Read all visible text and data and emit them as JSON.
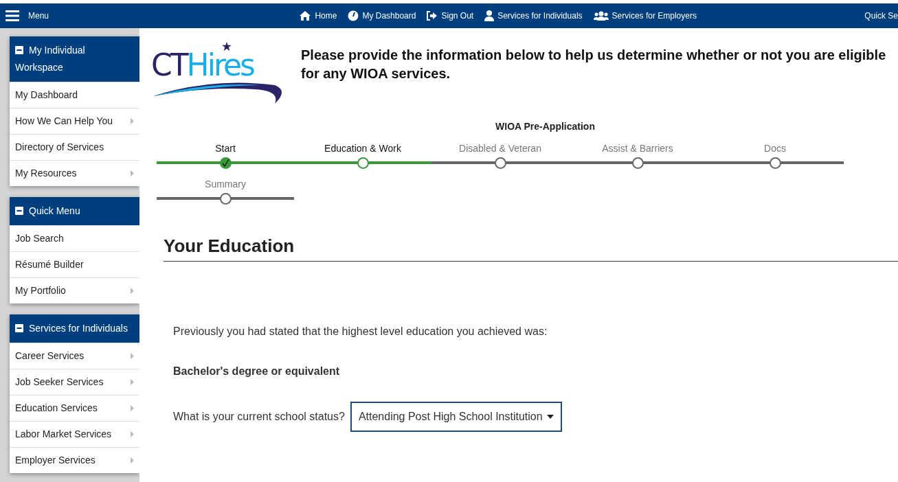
{
  "topbar": {
    "menu_label": "Menu",
    "links": [
      {
        "label": "Home"
      },
      {
        "label": "My Dashboard"
      },
      {
        "label": "Sign Out"
      },
      {
        "label": "Services for Individuals"
      },
      {
        "label": "Services for Employers"
      }
    ],
    "right_label": "Quick Se"
  },
  "sidebar": [
    {
      "title": "My Individual Workspace",
      "items": [
        {
          "label": "My Dashboard",
          "has_submenu": false
        },
        {
          "label": "How We Can Help You",
          "has_submenu": true
        },
        {
          "label": "Directory of Services",
          "has_submenu": false
        },
        {
          "label": "My Resources",
          "has_submenu": true
        }
      ]
    },
    {
      "title": "Quick Menu",
      "items": [
        {
          "label": "Job Search",
          "has_submenu": false
        },
        {
          "label": "Résumé Builder",
          "has_submenu": false
        },
        {
          "label": "My Portfolio",
          "has_submenu": true
        }
      ]
    },
    {
      "title": "Services for Individuals",
      "items": [
        {
          "label": "Career Services",
          "has_submenu": true
        },
        {
          "label": "Job Seeker Services",
          "has_submenu": true
        },
        {
          "label": "Education Services",
          "has_submenu": true
        },
        {
          "label": "Labor Market Services",
          "has_submenu": true
        },
        {
          "label": "Employer Services",
          "has_submenu": true
        }
      ]
    }
  ],
  "logo": [
    "CT",
    "Hires"
  ],
  "intro": "Please provide the information below to help us determine whether or not you are eligible for any WIOA services.",
  "progress": {
    "title": "WIOA Pre-Application",
    "steps": [
      {
        "label": "Start",
        "selected": false
      },
      {
        "label": "Education & Work",
        "selected": true
      },
      {
        "label": "Disabled & Veteran",
        "selected": false
      },
      {
        "label": "Assist & Barriers",
        "selected": false
      },
      {
        "label": "Docs",
        "selected": false
      },
      {
        "label": "Summary",
        "selected": false
      }
    ]
  },
  "section_title": "Your Education",
  "previous_statement": "Previously you had stated that the highest level education you achieved was:",
  "previous_education": "Bachelor's degree or equivalent",
  "school_status": {
    "label": "What is your current school status?",
    "value": "Attending Post High School Institution"
  }
}
